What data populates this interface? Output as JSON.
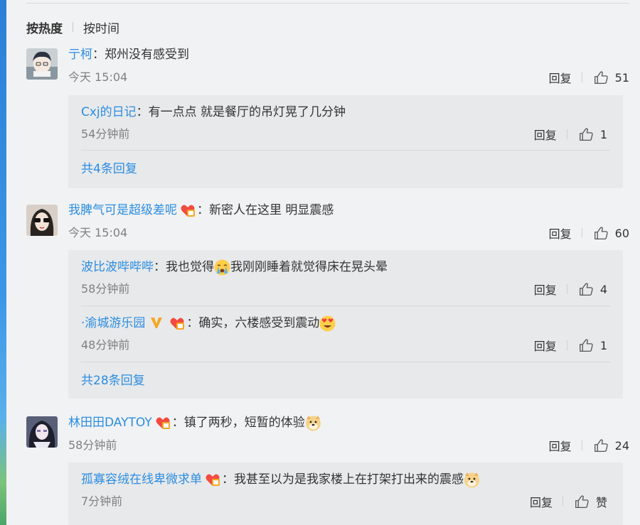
{
  "sort": {
    "hot": "按热度",
    "time": "按时间"
  },
  "labels": {
    "reply": "回复",
    "colon": "："
  },
  "comments": [
    {
      "user": "亍柯",
      "text": "郑州没有感受到",
      "time": "今天 15:04",
      "likes": "51",
      "replies": [
        {
          "user": "Cxj的日记",
          "text": "有一点点 就是餐厅的吊灯晃了几分钟",
          "time": "54分钟前",
          "likes": "1"
        }
      ],
      "more": "共4条回复"
    },
    {
      "user": "我脾气可是超级差呢",
      "text": "新密人在这里 明显震感",
      "time": "今天 15:04",
      "likes": "60",
      "replies": [
        {
          "user": "波比波哔哔哔",
          "text_a": "我也觉得",
          "emoji_a": "crying-emoji",
          "text_b": "我刚刚睡着就觉得床在晃头晕",
          "time": "58分钟前",
          "likes": "4"
        },
        {
          "user": "·渝城游乐园",
          "text": "确实，六楼感受到震动",
          "emoji": "heart-eyes-emoji",
          "time": "48分钟前",
          "likes": "1"
        }
      ],
      "more": "共28条回复"
    },
    {
      "user": "林田田DAYTOY",
      "text": "镇了两秒，短暂的体验",
      "emoji": "doge-emoji",
      "time": "58分钟前",
      "likes": "24",
      "replies": [
        {
          "user": "孤寡容绒在线卑微求单",
          "text": "我甚至以为是我家楼上在打架打出来的震感",
          "emoji": "doge-emoji",
          "time": "7分钟前",
          "likes": "赞"
        }
      ]
    }
  ],
  "colors": {
    "link": "#2b8de0",
    "meta": "#808080",
    "reply_bg": "#e8e9eb",
    "page_bg": "#f1f2f4"
  }
}
